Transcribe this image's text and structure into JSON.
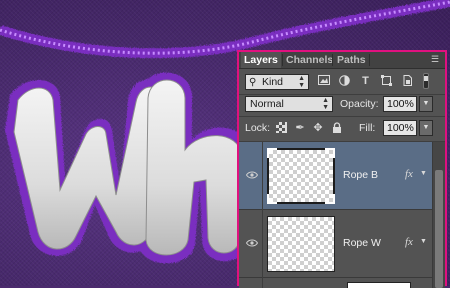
{
  "panel": {
    "tabs": [
      {
        "label": "Layers",
        "active": true
      },
      {
        "label": "Channels",
        "active": false
      },
      {
        "label": "Paths",
        "active": false
      }
    ],
    "menu_icon": "panel-menu-icon"
  },
  "filter": {
    "kind_label": "Kind",
    "filter_icons": [
      "image-filter-icon",
      "adjustment-filter-icon",
      "type-filter-icon",
      "shape-filter-icon",
      "smart-object-filter-icon"
    ]
  },
  "blend": {
    "mode": "Normal",
    "opacity_label": "Opacity:",
    "opacity_value": "100%"
  },
  "lock": {
    "label": "Lock:",
    "fill_label": "Fill:",
    "fill_value": "100%"
  },
  "layers": [
    {
      "name": "Rope B",
      "fx": "fx",
      "selected": true,
      "visible": true
    },
    {
      "name": "Rope W",
      "fx": "fx",
      "selected": false,
      "visible": true
    }
  ],
  "colors": {
    "panel_bg": "#535353",
    "panel_border": "#e0117f",
    "selected_row": "#5a6d86",
    "background": "#4b2a6e",
    "rope": "#9b3fe0"
  }
}
